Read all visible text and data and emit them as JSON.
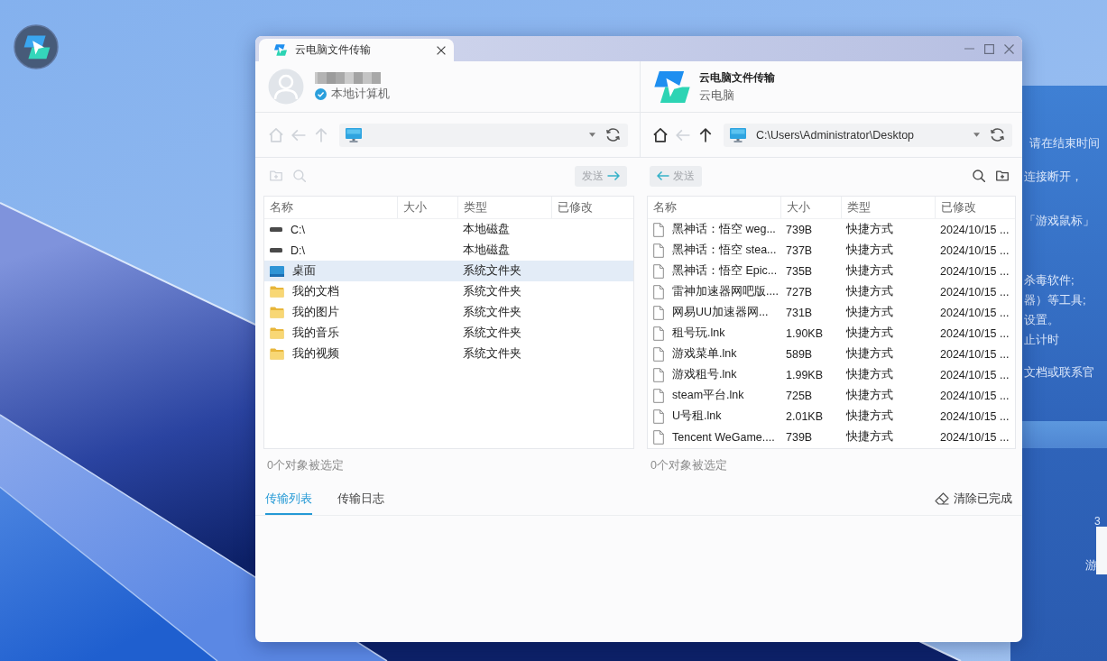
{
  "desktop": {
    "background_window": {
      "paragraphs": [
        [
          "请在结束时间"
        ],
        [
          "连接断开，"
        ],
        [
          "「游戏鼠标」"
        ],
        [
          "杀毒软件;",
          "器）等工具;",
          "设置。",
          "止计时"
        ],
        [
          "文档或联系官"
        ]
      ],
      "lower_fragments": [
        "3",
        "游"
      ]
    }
  },
  "window": {
    "tab": {
      "title": "云电脑文件传输"
    },
    "panes": [
      {
        "kind": "local",
        "subtitle": "本地计算机",
        "nav": [
          {
            "kind": "home",
            "disabled": true
          },
          {
            "kind": "back",
            "disabled": true
          },
          {
            "kind": "up",
            "disabled": true
          }
        ],
        "tools": [
          {
            "kind": "new-folder",
            "disabled": true
          },
          {
            "kind": "search",
            "disabled": true
          }
        ],
        "send": {
          "label": "发送",
          "kind": "upload",
          "disabled": true
        },
        "table": {
          "columns": [
            "名称",
            "大小",
            "类型",
            "已修改"
          ],
          "rows": [
            {
              "kind": "drive",
              "name": "C:\\",
              "type": "本地磁盘",
              "selected": false
            },
            {
              "kind": "drive",
              "name": "D:\\",
              "type": "本地磁盘",
              "selected": false
            },
            {
              "kind": "desktop",
              "name": "桌面",
              "type": "系统文件夹",
              "selected": true
            },
            {
              "kind": "folder",
              "name": "我的文档",
              "type": "系统文件夹",
              "selected": false
            },
            {
              "kind": "folder",
              "name": "我的图片",
              "type": "系统文件夹",
              "selected": false
            },
            {
              "kind": "folder",
              "name": "我的音乐",
              "type": "系统文件夹",
              "selected": false
            },
            {
              "kind": "folder",
              "name": "我的视频",
              "type": "系统文件夹",
              "selected": false
            }
          ]
        },
        "status": "0个对象被选定"
      },
      {
        "kind": "cloud",
        "title": "云电脑文件传输",
        "subtitle": "云电脑",
        "nav": [
          {
            "kind": "home",
            "disabled": false
          },
          {
            "kind": "back",
            "disabled": true
          },
          {
            "kind": "up",
            "disabled": false
          }
        ],
        "address": {
          "path": "C:\\Users\\Administrator\\Desktop"
        },
        "tools": [
          {
            "kind": "search",
            "disabled": false
          },
          {
            "kind": "new-folder",
            "disabled": false
          }
        ],
        "send": {
          "label": "发送",
          "kind": "download",
          "disabled": true
        },
        "table": {
          "columns": [
            "名称",
            "大小",
            "类型",
            "已修改"
          ],
          "rows": [
            {
              "kind": "file",
              "name": "黑神话：悟空 weg...",
              "size": "739B",
              "type": "快捷方式",
              "modified": "2024/10/15 ...",
              "selected": false
            },
            {
              "kind": "file",
              "name": "黑神话：悟空 stea...",
              "size": "737B",
              "type": "快捷方式",
              "modified": "2024/10/15 ...",
              "selected": false
            },
            {
              "kind": "file",
              "name": "黑神话：悟空 Epic...",
              "size": "735B",
              "type": "快捷方式",
              "modified": "2024/10/15 ...",
              "selected": false
            },
            {
              "kind": "file",
              "name": "雷神加速器网吧版....",
              "size": "727B",
              "type": "快捷方式",
              "modified": "2024/10/15 ...",
              "selected": false
            },
            {
              "kind": "file",
              "name": "网易UU加速器网...",
              "size": "731B",
              "type": "快捷方式",
              "modified": "2024/10/15 ...",
              "selected": false
            },
            {
              "kind": "file",
              "name": "租号玩.lnk",
              "size": "1.90KB",
              "type": "快捷方式",
              "modified": "2024/10/15 ...",
              "selected": false
            },
            {
              "kind": "file",
              "name": "游戏菜单.lnk",
              "size": "589B",
              "type": "快捷方式",
              "modified": "2024/10/15 ...",
              "selected": false
            },
            {
              "kind": "file",
              "name": "游戏租号.lnk",
              "size": "1.99KB",
              "type": "快捷方式",
              "modified": "2024/10/15 ...",
              "selected": false
            },
            {
              "kind": "file",
              "name": "steam平台.lnk",
              "size": "725B",
              "type": "快捷方式",
              "modified": "2024/10/15 ...",
              "selected": false
            },
            {
              "kind": "file",
              "name": "U号租.lnk",
              "size": "2.01KB",
              "type": "快捷方式",
              "modified": "2024/10/15 ...",
              "selected": false
            },
            {
              "kind": "file",
              "name": "Tencent WeGame....",
              "size": "739B",
              "type": "快捷方式",
              "modified": "2024/10/15 ...",
              "selected": false
            }
          ]
        },
        "status": "0个对象被选定"
      }
    ],
    "transfer": {
      "tabs": [
        {
          "label": "传输列表",
          "selected": true
        },
        {
          "label": "传输日志",
          "selected": false
        }
      ],
      "clear_button": "清除已完成"
    }
  }
}
